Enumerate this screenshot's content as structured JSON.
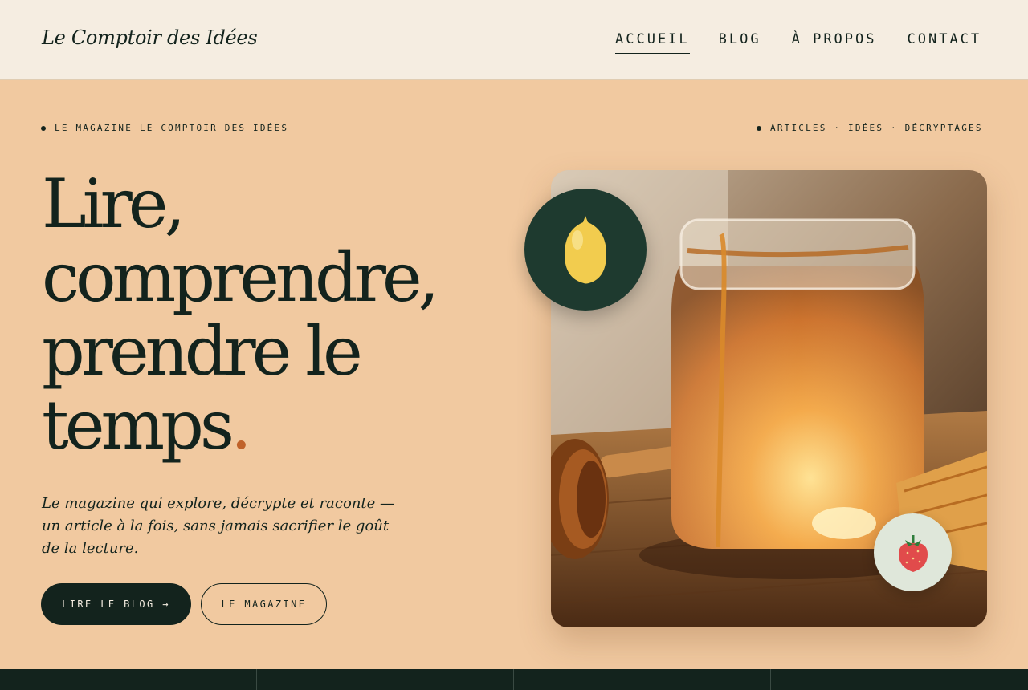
{
  "header": {
    "logo": "Le Comptoir des Idées",
    "nav": [
      {
        "label": "ACCUEIL",
        "active": true
      },
      {
        "label": "BLOG",
        "active": false
      },
      {
        "label": "À PROPOS",
        "active": false
      },
      {
        "label": "CONTACT",
        "active": false
      }
    ]
  },
  "hero": {
    "eyebrow_left": "LE MAGAZINE LE COMPTOIR DES IDÉES",
    "eyebrow_right": "ARTICLES · IDÉES · DÉCRYPTAGES",
    "headline": [
      "Lire,",
      "comprendre,",
      "prendre le",
      "temps"
    ],
    "headline_accent": ".",
    "lede": "Le magazine qui explore, décrypte et raconte — un article à la fois, sans jamais sacrifier le goût de la lecture.",
    "primary_button": "LIRE LE BLOG →",
    "secondary_button": "LE MAGAZINE",
    "image_subject": "honey-jar-photo",
    "badges": [
      "lemon-icon",
      "strawberry-icon"
    ]
  },
  "colors": {
    "background": "#f1c9a0",
    "header_bg": "#f5ede1",
    "ink": "#13231d",
    "accent": "#c0622a",
    "badge_dark": "#1e3a2f",
    "badge_light": "#dfe7da"
  }
}
